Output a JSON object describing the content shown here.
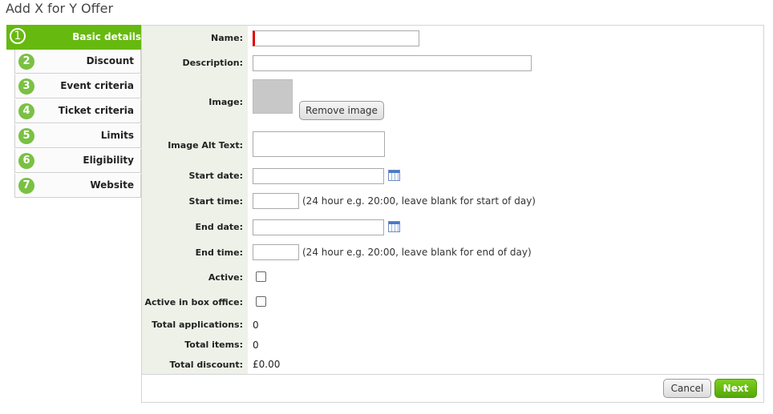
{
  "page": {
    "title": "Add X for Y Offer"
  },
  "steps": [
    {
      "num": "1",
      "label": "Basic details",
      "active": true
    },
    {
      "num": "2",
      "label": "Discount"
    },
    {
      "num": "3",
      "label": "Event criteria"
    },
    {
      "num": "4",
      "label": "Ticket criteria"
    },
    {
      "num": "5",
      "label": "Limits"
    },
    {
      "num": "6",
      "label": "Eligibility"
    },
    {
      "num": "7",
      "label": "Website"
    }
  ],
  "form": {
    "name_label": "Name:",
    "name_value": "",
    "description_label": "Description:",
    "description_value": "",
    "image_label": "Image:",
    "remove_image_label": "Remove image",
    "image_alt_label": "Image Alt Text:",
    "image_alt_value": "",
    "start_date_label": "Start date:",
    "start_date_value": "",
    "start_time_label": "Start time:",
    "start_time_value": "",
    "start_time_hint": "(24 hour e.g. 20:00, leave blank for start of day)",
    "end_date_label": "End date:",
    "end_date_value": "",
    "end_time_label": "End time:",
    "end_time_value": "",
    "end_time_hint": "(24 hour e.g. 20:00, leave blank for end of day)",
    "active_label": "Active:",
    "active_checked": false,
    "box_office_label": "Active in box office:",
    "box_office_checked": false,
    "total_applications_label": "Total applications:",
    "total_applications_value": "0",
    "total_items_label": "Total items:",
    "total_items_value": "0",
    "total_discount_label": "Total discount:",
    "total_discount_value": "£0.00"
  },
  "footer": {
    "cancel_label": "Cancel",
    "next_label": "Next"
  },
  "colors": {
    "accent": "#66b90f",
    "step_number": "#7ac143",
    "required": "#e00000",
    "label_bg": "#eef1e8"
  }
}
